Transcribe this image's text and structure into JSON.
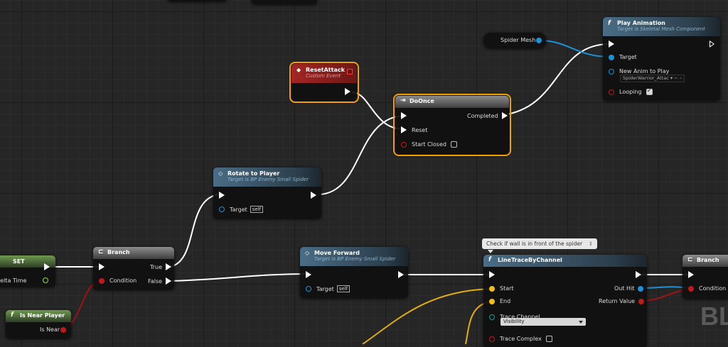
{
  "nodes": {
    "play_animation": {
      "title": "Play Animation",
      "subtitle": "Target is Skeletal Mesh Component",
      "target": "Target",
      "new_anim": "New Anim to Play",
      "anim_value": "SpiderWarrior_Attac",
      "looping": "Looping",
      "looping_checked": true
    },
    "spider_mesh": {
      "label": "Spider Mesh"
    },
    "reset_attack": {
      "title": "ResetAttack",
      "subtitle": "Custom Event"
    },
    "do_once": {
      "title": "DoOnce",
      "completed": "Completed",
      "reset": "Reset",
      "start_closed": "Start Closed"
    },
    "rotate_to_player": {
      "title": "Rotate to Player",
      "subtitle": "Target is BP Enemy Small Spider",
      "target": "Target",
      "self": "self"
    },
    "set": {
      "title": "SET",
      "delta_time": "Delta Time"
    },
    "branch_left": {
      "title": "Branch",
      "condition": "Condition",
      "true_label": "True",
      "false_label": "False"
    },
    "is_near_player": {
      "title": "Is Near Player",
      "output": "Is Near"
    },
    "move_forward": {
      "title": "Move Forward",
      "subtitle": "Target is BP Enemy Small Spider",
      "target": "Target",
      "self": "self"
    },
    "line_trace": {
      "comment": "Check if wall is in front of the spider",
      "title": "LineTraceByChannel",
      "start": "Start",
      "end": "End",
      "trace_channel": "Trace Channel",
      "trace_value": "Visibility",
      "trace_complex": "Trace Complex",
      "out_hit": "Out Hit",
      "return_value": "Return Value"
    },
    "branch_right": {
      "title": "Branch",
      "condition": "Condition"
    }
  },
  "watermark": "BL"
}
